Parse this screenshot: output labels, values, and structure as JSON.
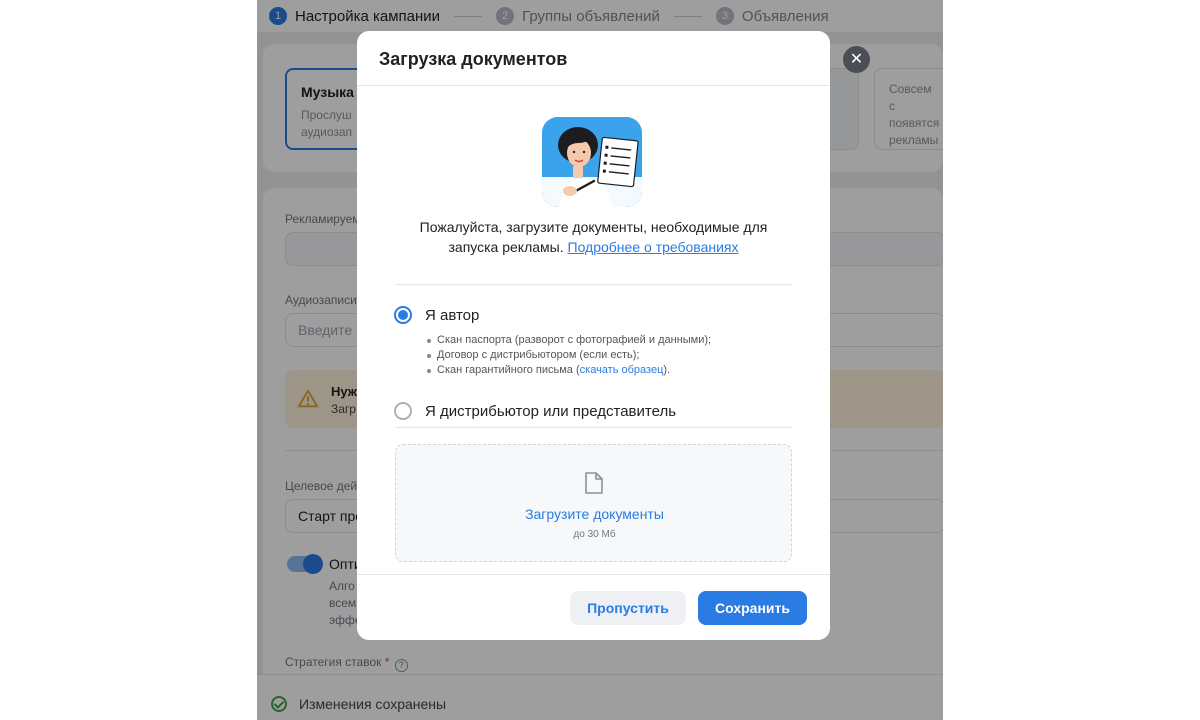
{
  "stepper": {
    "steps": [
      {
        "num": "1",
        "label": "Настройка кампании"
      },
      {
        "num": "2",
        "label": "Группы объявлений"
      },
      {
        "num": "3",
        "label": "Объявления"
      }
    ]
  },
  "objective_cards": {
    "selected": {
      "title": "Музыка",
      "desc_line1": "Прослуш",
      "desc_line2": "аудиозап"
    },
    "right": {
      "line1": "Совсем с",
      "line2": "появятся",
      "line3": "рекламы"
    }
  },
  "form": {
    "advertised_label": "Рекламируем",
    "audio_label": "Аудиозаписи",
    "audio_placeholder": "Введите к",
    "warning_title": "Нуж",
    "warning_text": "Загр",
    "target_label": "Целевое дей",
    "target_value": "Старт про",
    "optimization_title": "Опти",
    "optimization_desc_1": "Алго",
    "optimization_desc_2": "всем",
    "optimization_desc_3": "эффе",
    "bid_strategy_label": "Стратегия ставок",
    "bid_required_mark": "*"
  },
  "status": {
    "text": "Изменения сохранены"
  },
  "modal": {
    "title": "Загрузка документов",
    "description": "Пожалуйста, загрузите документы, необходимые для запуска рекламы.",
    "requirements_link": "Подробнее о требованиях",
    "options": [
      {
        "label": "Я автор",
        "checked": true
      },
      {
        "label": "Я дистрибьютор или представитель",
        "checked": false
      }
    ],
    "author_docs": [
      "Скан паспорта (разворот с фотографией и данными);",
      "Договор с дистрибьютором (если есть);"
    ],
    "letter_doc_prefix": "Скан гарантийного письма (",
    "letter_doc_link": "скачать образец",
    "letter_doc_suffix": ").",
    "upload_label": "Загрузите документы",
    "upload_limit": "до 30 Мб",
    "skip_label": "Пропустить",
    "save_label": "Сохранить",
    "close_symbol": "✕"
  },
  "colors": {
    "accent": "#2a7be4",
    "success": "#3fa24a",
    "warning_bg": "#fdf1dc"
  }
}
